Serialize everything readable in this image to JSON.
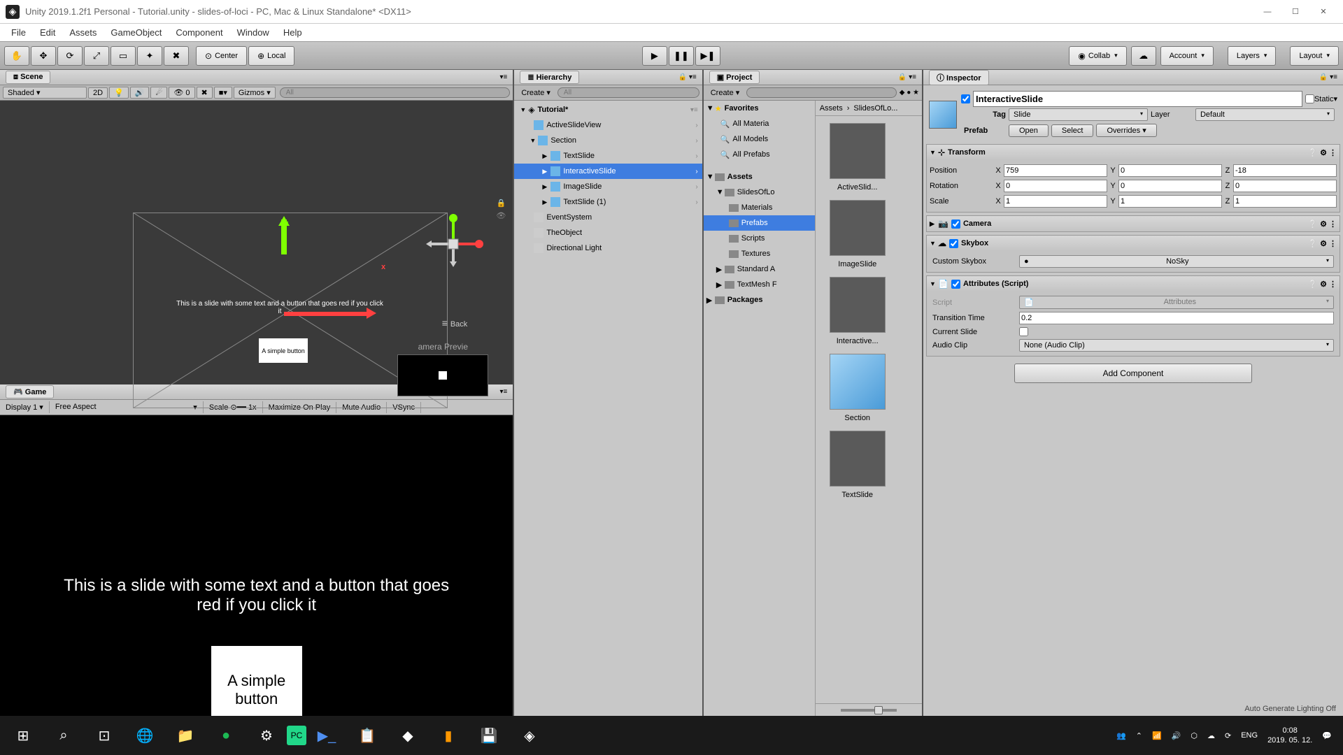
{
  "window": {
    "title": "Unity 2019.1.2f1 Personal - Tutorial.unity - slides-of-loci - PC, Mac & Linux Standalone* <DX11>"
  },
  "menu": [
    "File",
    "Edit",
    "Assets",
    "GameObject",
    "Component",
    "Window",
    "Help"
  ],
  "toolbar": {
    "center": "Center",
    "local": "Local",
    "collab": "Collab",
    "account": "Account",
    "layers": "Layers",
    "layout": "Layout"
  },
  "scene": {
    "tab": "Scene",
    "shading": "Shaded",
    "twoD": "2D",
    "gizmos": "Gizmos",
    "search_placeholder": "All",
    "slideText": "This is a slide with some text and a button that goes red if you click it",
    "buttonText": "A simple button",
    "back": "Back",
    "camPreview": "amera Previe",
    "zero": "0"
  },
  "game": {
    "tab": "Game",
    "display": "Display 1",
    "aspect": "Free Aspect",
    "scale": "Scale",
    "scaleVal": "1x",
    "maximize": "Maximize On Play",
    "mute": "Mute Audio",
    "vsync": "VSync",
    "slideText": "This is a slide with some text and a button that goes red if you click it",
    "buttonText": "A simple button"
  },
  "hierarchy": {
    "tab": "Hierarchy",
    "create": "Create",
    "search_placeholder": "All",
    "root": "Tutorial*",
    "items": [
      "ActiveSlideView",
      "Section",
      "TextSlide",
      "InteractiveSlide",
      "ImageSlide",
      "TextSlide (1)",
      "EventSystem",
      "TheObject",
      "Directional Light"
    ]
  },
  "project": {
    "tab": "Project",
    "create": "Create",
    "search_placeholder": "",
    "breadcrumb": [
      "Assets",
      "SlidesOfLo..."
    ],
    "favorites": "Favorites",
    "fav_items": [
      "All Materia",
      "All Models",
      "All Prefabs"
    ],
    "assets": "Assets",
    "folders": [
      "SlidesOfLo",
      "Materials",
      "Prefabs",
      "Scripts",
      "Textures",
      "Standard A",
      "TextMesh F"
    ],
    "packages": "Packages",
    "grid": [
      "ActiveSlid...",
      "ImageSlide",
      "Interactive...",
      "Section",
      "TextSlide"
    ]
  },
  "inspector": {
    "tab": "Inspector",
    "name": "InteractiveSlide",
    "static": "Static",
    "tag_label": "Tag",
    "tag": "Slide",
    "layer_label": "Layer",
    "layer": "Default",
    "prefab_label": "Prefab",
    "open": "Open",
    "select": "Select",
    "overrides": "Overrides",
    "transform": {
      "title": "Transform",
      "pos": "Position",
      "px": "759",
      "py": "0",
      "pz": "-18",
      "rot": "Rotation",
      "rx": "0",
      "ry": "0",
      "rz": "0",
      "scale": "Scale",
      "sx": "1",
      "sy": "1",
      "sz": "1"
    },
    "camera": {
      "title": "Camera"
    },
    "skybox": {
      "title": "Skybox",
      "custom_label": "Custom Skybox",
      "custom": "NoSky"
    },
    "attributes": {
      "title": "Attributes (Script)",
      "script_label": "Script",
      "script": "Attributes",
      "tt_label": "Transition Time",
      "tt": "0.2",
      "cs_label": "Current Slide",
      "ac_label": "Audio Clip",
      "ac": "None (Audio Clip)"
    },
    "addcomp": "Add Component",
    "lighting": "Auto Generate Lighting Off"
  },
  "taskbar": {
    "lang": "ENG",
    "time": "0:08",
    "date": "2019. 05. 12."
  }
}
